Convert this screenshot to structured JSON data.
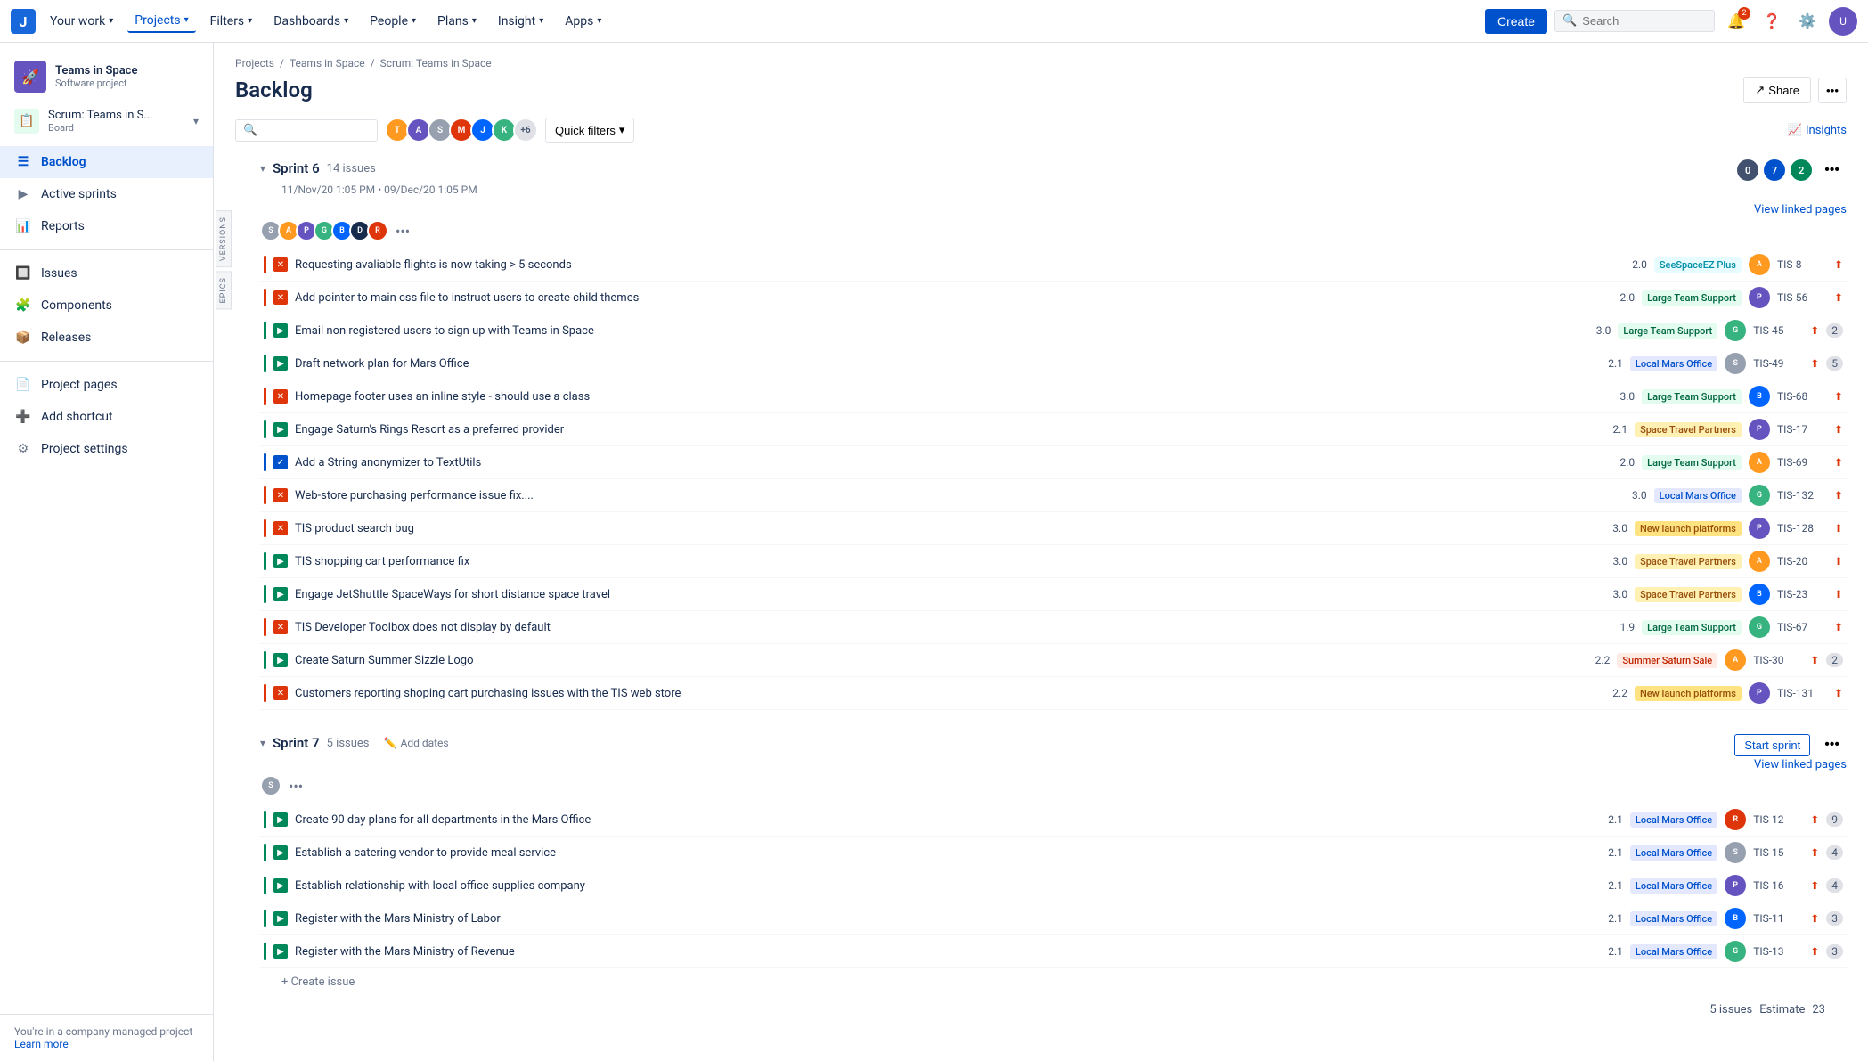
{
  "nav": {
    "logo_alt": "Jira",
    "items": [
      {
        "label": "Your work",
        "active": false
      },
      {
        "label": "Projects",
        "active": true
      },
      {
        "label": "Filters",
        "active": false
      },
      {
        "label": "Dashboards",
        "active": false
      },
      {
        "label": "People",
        "active": false
      },
      {
        "label": "Plans",
        "active": false
      },
      {
        "label": "Insight",
        "active": false
      },
      {
        "label": "Apps",
        "active": false
      }
    ],
    "create_label": "Create",
    "search_placeholder": "Search",
    "notification_count": "2"
  },
  "sidebar": {
    "project_name": "Teams in Space",
    "project_type": "Software project",
    "board_name": "Scrum: Teams in S...",
    "board_type": "Board",
    "nav_items": [
      {
        "label": "Backlog",
        "active": true,
        "icon": "list"
      },
      {
        "label": "Active sprints",
        "active": false,
        "icon": "sprint"
      },
      {
        "label": "Reports",
        "active": false,
        "icon": "chart"
      },
      {
        "label": "Issues",
        "active": false,
        "icon": "issues"
      },
      {
        "label": "Components",
        "active": false,
        "icon": "components"
      },
      {
        "label": "Releases",
        "active": false,
        "icon": "releases"
      },
      {
        "label": "Project pages",
        "active": false,
        "icon": "pages"
      },
      {
        "label": "Add shortcut",
        "active": false,
        "icon": "add"
      },
      {
        "label": "Project settings",
        "active": false,
        "icon": "settings"
      }
    ],
    "bottom_text": "You're in a company-managed project",
    "learn_more": "Learn more"
  },
  "breadcrumb": {
    "items": [
      "Projects",
      "Teams in Space",
      "Scrum: Teams in Space"
    ]
  },
  "page": {
    "title": "Backlog",
    "share_label": "Share",
    "insights_label": "Insights"
  },
  "toolbar": {
    "search_placeholder": "",
    "quick_filters_label": "Quick filters",
    "avatars_extra": "+6",
    "insights_label": "Insights"
  },
  "versions_label": "VERSIONS",
  "epics_label": "EPICS",
  "sprint6": {
    "title": "Sprint 6",
    "count": "14 issues",
    "dates": "11/Nov/20 1:05 PM  •  09/Dec/20 1:05 PM",
    "status": {
      "gray": "0",
      "blue": "7",
      "green": "2"
    },
    "view_linked_pages": "View linked pages",
    "issues": [
      {
        "type": "bug",
        "border": "red",
        "title": "Requesting avaliable flights is now taking > 5 seconds",
        "points": "2.0",
        "tag": "SeeSpaceEZ Plus",
        "tag_class": "tag-seespace",
        "avatar_class": "av-orange",
        "avatar_letter": "A",
        "id": "TIS-8",
        "priority": "🔴",
        "comments": ""
      },
      {
        "type": "bug",
        "border": "red",
        "title": "Add pointer to main css file to instruct users to create child themes",
        "points": "2.0",
        "tag": "Large Team Support",
        "tag_class": "tag-large-team",
        "avatar_class": "av-purple",
        "avatar_letter": "P",
        "id": "TIS-56",
        "priority": "🔴",
        "comments": ""
      },
      {
        "type": "story",
        "border": "green",
        "title": "Email non registered users to sign up with Teams in Space",
        "points": "3.0",
        "tag": "Large Team Support",
        "tag_class": "tag-large-team",
        "avatar_class": "av-green",
        "avatar_letter": "G",
        "id": "TIS-45",
        "priority": "🔴",
        "comments": "2"
      },
      {
        "type": "story",
        "border": "green",
        "title": "Draft network plan for Mars Office",
        "points": "2.1",
        "tag": "Local Mars Office",
        "tag_class": "tag-local-mars",
        "avatar_class": "av-gray",
        "avatar_letter": "S",
        "id": "TIS-49",
        "priority": "🔵",
        "comments": "5"
      },
      {
        "type": "bug",
        "border": "red",
        "title": "Homepage footer uses an inline style - should use a class",
        "points": "3.0",
        "tag": "Large Team Support",
        "tag_class": "tag-large-team",
        "avatar_class": "av-blue",
        "avatar_letter": "B",
        "id": "TIS-68",
        "priority": "🔴",
        "comments": ""
      },
      {
        "type": "story",
        "border": "green",
        "title": "Engage Saturn's Rings Resort as a preferred provider",
        "points": "2.1",
        "tag": "Space Travel Partners",
        "tag_class": "tag-space-travel",
        "avatar_class": "av-purple",
        "avatar_letter": "P",
        "id": "TIS-17",
        "priority": "🔴",
        "comments": ""
      },
      {
        "type": "task",
        "border": "blue",
        "title": "Add a String anonymizer to TextUtils",
        "points": "2.0",
        "tag": "Large Team Support",
        "tag_class": "tag-large-team",
        "avatar_class": "av-orange",
        "avatar_letter": "A",
        "id": "TIS-69",
        "priority": "🔴",
        "comments": ""
      },
      {
        "type": "bug",
        "border": "red",
        "title": "Web-store purchasing performance issue fix....",
        "points": "3.0",
        "tag": "Local Mars Office",
        "tag_class": "tag-local-mars",
        "avatar_class": "av-green",
        "avatar_letter": "G",
        "id": "TIS-132",
        "priority": "🔵",
        "comments": ""
      },
      {
        "type": "bug",
        "border": "red",
        "title": "TIS product search bug",
        "points": "3.0",
        "tag": "New launch platforms",
        "tag_class": "tag-new-launch",
        "avatar_class": "av-purple",
        "avatar_letter": "P",
        "id": "TIS-128",
        "priority": "○",
        "comments": ""
      },
      {
        "type": "story",
        "border": "green",
        "title": "TIS shopping cart performance fix",
        "points": "3.0",
        "tag": "Space Travel Partners",
        "tag_class": "tag-space-travel",
        "avatar_class": "av-orange",
        "avatar_letter": "A",
        "id": "TIS-20",
        "priority": "🔴",
        "comments": ""
      },
      {
        "type": "story",
        "border": "green",
        "title": "Engage JetShuttle SpaceWays for short distance space travel",
        "points": "3.0",
        "tag": "Space Travel Partners",
        "tag_class": "tag-space-travel",
        "avatar_class": "av-blue",
        "avatar_letter": "B",
        "id": "TIS-23",
        "priority": "🔴",
        "comments": ""
      },
      {
        "type": "bug",
        "border": "red",
        "title": "TIS Developer Toolbox does not display by default",
        "points": "1.9",
        "tag": "Large Team Support",
        "tag_class": "tag-large-team",
        "avatar_class": "av-green",
        "avatar_letter": "G",
        "id": "TIS-67",
        "priority": "🔴",
        "comments": ""
      },
      {
        "type": "story",
        "border": "green",
        "title": "Create Saturn Summer Sizzle Logo",
        "points": "2.2",
        "tag": "Summer Saturn Sale",
        "tag_class": "tag-summer",
        "avatar_class": "av-orange",
        "avatar_letter": "A",
        "id": "TIS-30",
        "priority": "🔴",
        "comments": "2"
      },
      {
        "type": "bug",
        "border": "red",
        "title": "Customers reporting shoping cart purchasing issues with the TIS web store",
        "points": "2.2",
        "tag": "New launch platforms",
        "tag_class": "tag-new-launch",
        "avatar_class": "av-purple",
        "avatar_letter": "P",
        "id": "TIS-131",
        "priority": "🔴",
        "comments": ""
      }
    ]
  },
  "sprint7": {
    "title": "Sprint 7",
    "count": "5 issues",
    "add_dates_label": "Add dates",
    "start_sprint_label": "Start sprint",
    "view_linked_pages": "View linked pages",
    "issues": [
      {
        "type": "story",
        "border": "green",
        "title": "Create 90 day plans for all departments in the Mars Office",
        "points": "2.1",
        "tag": "Local Mars Office",
        "tag_class": "tag-local-mars",
        "avatar_class": "av-red",
        "avatar_letter": "R",
        "id": "TIS-12",
        "priority": "🔴",
        "comments": "9"
      },
      {
        "type": "story",
        "border": "green",
        "title": "Establish a catering vendor to provide meal service",
        "points": "2.1",
        "tag": "Local Mars Office",
        "tag_class": "tag-local-mars",
        "avatar_class": "av-gray",
        "avatar_letter": "S",
        "id": "TIS-15",
        "priority": "🔴",
        "comments": "4"
      },
      {
        "type": "story",
        "border": "green",
        "title": "Establish relationship with local office supplies company",
        "points": "2.1",
        "tag": "Local Mars Office",
        "tag_class": "tag-local-mars",
        "avatar_class": "av-purple",
        "avatar_letter": "P",
        "id": "TIS-16",
        "priority": "🔴",
        "comments": "4"
      },
      {
        "type": "story",
        "border": "green",
        "title": "Register with the Mars Ministry of Labor",
        "points": "2.1",
        "tag": "Local Mars Office",
        "tag_class": "tag-local-mars",
        "avatar_class": "av-blue",
        "avatar_letter": "B",
        "id": "TIS-11",
        "priority": "🔴",
        "comments": "3"
      },
      {
        "type": "story",
        "border": "green",
        "title": "Register with the Mars Ministry of Revenue",
        "points": "2.1",
        "tag": "Local Mars Office",
        "tag_class": "tag-local-mars",
        "avatar_class": "av-green",
        "avatar_letter": "G",
        "id": "TIS-13",
        "priority": "🔴",
        "comments": "3"
      }
    ]
  },
  "bottom": {
    "issues_count": "5 issues",
    "estimate_label": "Estimate",
    "estimate_value": "23"
  },
  "create_issue_label": "+ Create issue"
}
